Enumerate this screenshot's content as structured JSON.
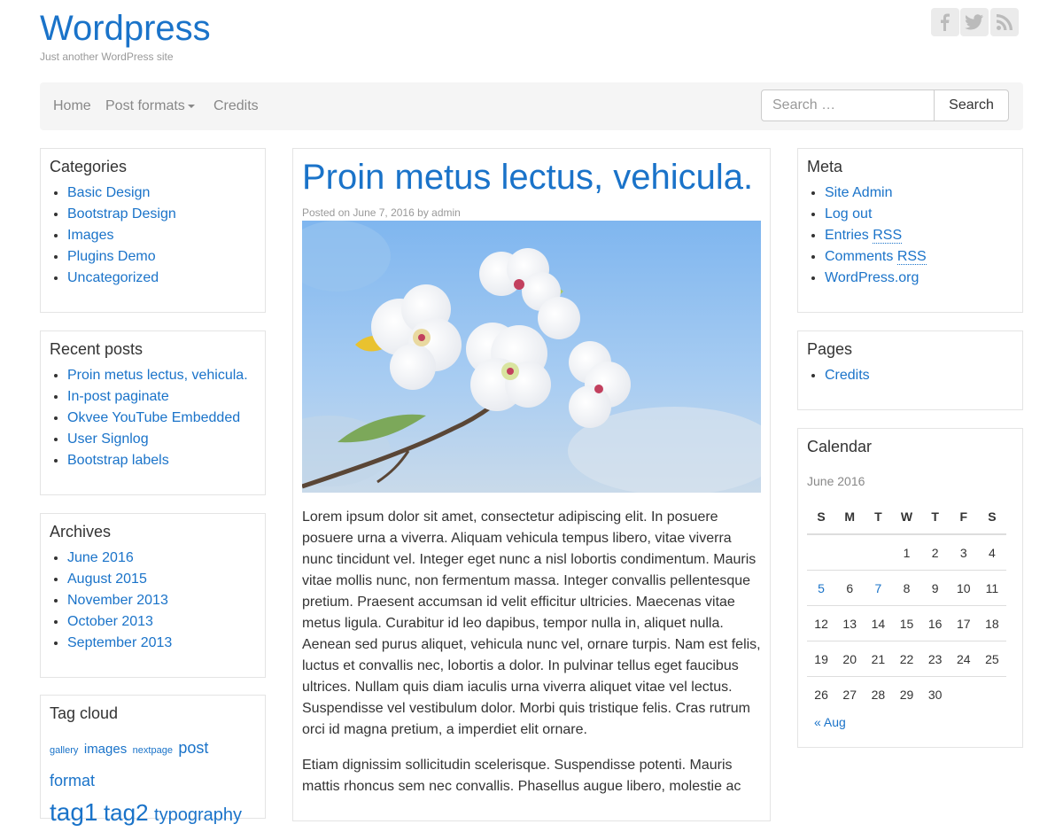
{
  "header": {
    "site_title": "Wordpress",
    "tagline": "Just another WordPress site",
    "social": [
      {
        "name": "facebook-icon",
        "glyph": "f"
      },
      {
        "name": "twitter-icon",
        "glyph": "t"
      },
      {
        "name": "rss-icon",
        "glyph": "rss"
      }
    ]
  },
  "nav": {
    "home": "Home",
    "post_formats": "Post formats",
    "credits": "Credits",
    "search_placeholder": "Search …",
    "search_button": "Search"
  },
  "categories": {
    "title": "Categories",
    "items": [
      "Basic Design",
      "Bootstrap Design",
      "Images",
      "Plugins Demo",
      "Uncategorized"
    ]
  },
  "recent_posts": {
    "title": "Recent posts",
    "items": [
      "Proin metus lectus, vehicula.",
      "In-post paginate",
      "Okvee YouTube Embedded",
      "User Signlog",
      "Bootstrap labels"
    ]
  },
  "archives": {
    "title": "Archives",
    "items": [
      "June 2016",
      "August 2015",
      "November 2013",
      "October 2013",
      "September 2013"
    ]
  },
  "tag_cloud": {
    "title": "Tag cloud",
    "tags": [
      "gallery",
      "images",
      "nextpage",
      "post format",
      "tag1",
      "tag2",
      "typography"
    ]
  },
  "post": {
    "title": "Proin metus lectus, vehicula.",
    "posted_on": "Posted on",
    "date": "June 7, 2016",
    "by": "by",
    "author": "admin",
    "paragraph1": "Lorem ipsum dolor sit amet, consectetur adipiscing elit. In posuere posuere urna a viverra. Aliquam vehicula tempus libero, vitae viverra nunc tincidunt vel. Integer eget nunc a nisl lobortis condimentum. Mauris vitae mollis nunc, non fermentum massa. Integer convallis pellentesque pretium. Praesent accumsan id velit efficitur ultricies. Maecenas vitae metus ligula. Curabitur id leo dapibus, tempor nulla in, aliquet nulla. Aenean sed purus aliquet, vehicula nunc vel, ornare turpis. Nam est felis, luctus et convallis nec, lobortis a dolor. In pulvinar tellus eget faucibus ultrices. Nullam quis diam iaculis urna viverra aliquet vitae vel lectus. Suspendisse vel vestibulum dolor. Morbi quis tristique felis. Cras rutrum orci id magna pretium, a imperdiet elit ornare.",
    "paragraph2": "Etiam dignissim sollicitudin scelerisque. Suspendisse potenti. Mauris mattis rhoncus sem nec convallis. Phasellus augue libero, molestie ac"
  },
  "meta": {
    "title": "Meta",
    "site_admin": "Site Admin",
    "log_out": "Log out",
    "entries": "Entries",
    "comments": "Comments",
    "rss": "RSS",
    "wordpress_org": "WordPress.org"
  },
  "pages": {
    "title": "Pages",
    "items": [
      "Credits"
    ]
  },
  "calendar": {
    "title": "Calendar",
    "caption": "June 2016",
    "weekdays": [
      "S",
      "M",
      "T",
      "W",
      "T",
      "F",
      "S"
    ],
    "weeks": [
      [
        "",
        "",
        "",
        "1",
        "2",
        "3",
        "4"
      ],
      [
        "5",
        "6",
        "7",
        "8",
        "9",
        "10",
        "11"
      ],
      [
        "12",
        "13",
        "14",
        "15",
        "16",
        "17",
        "18"
      ],
      [
        "19",
        "20",
        "21",
        "22",
        "23",
        "24",
        "25"
      ],
      [
        "26",
        "27",
        "28",
        "29",
        "30",
        "",
        ""
      ]
    ],
    "linked_days": [
      "5",
      "7"
    ],
    "prev": "« Aug"
  },
  "colors": {
    "link": "#1a73c9",
    "navbar_bg": "#f5f5f5",
    "muted": "#999999"
  }
}
